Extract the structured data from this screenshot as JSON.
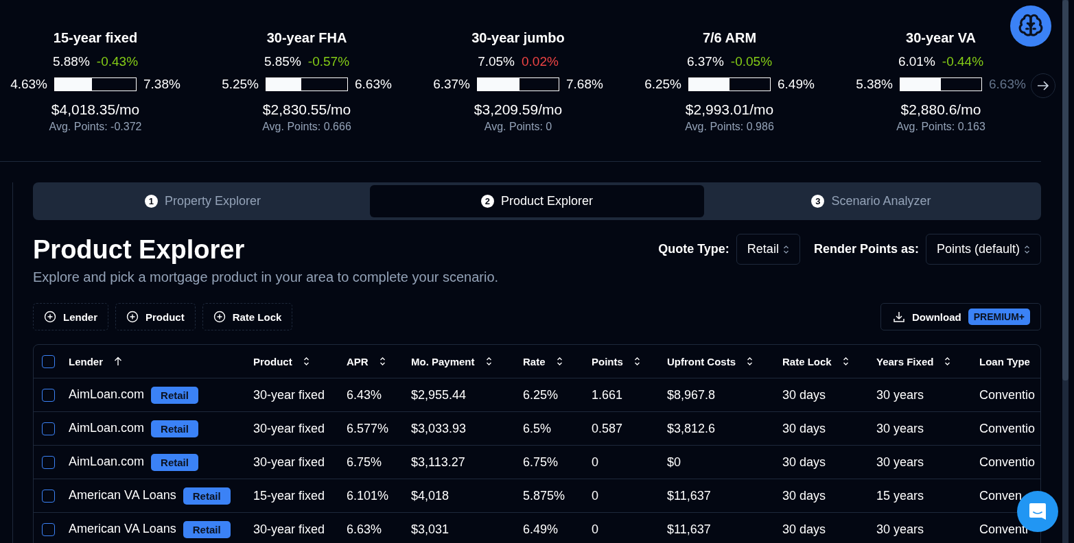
{
  "rates": [
    {
      "title": "15-year fixed",
      "rate": "5.88%",
      "change": "-0.43%",
      "kind": "down",
      "low": "4.63%",
      "high": "7.38%",
      "level": 0.46,
      "payment": "$4,018.35/mo",
      "points": "Avg. Points: -0.372"
    },
    {
      "title": "30-year FHA",
      "rate": "5.85%",
      "change": "-0.57%",
      "kind": "down",
      "low": "5.25%",
      "high": "6.63%",
      "level": 0.43,
      "payment": "$2,830.55/mo",
      "points": "Avg. Points: 0.666"
    },
    {
      "title": "30-year jumbo",
      "rate": "7.05%",
      "change": "0.02%",
      "kind": "up",
      "low": "6.37%",
      "high": "7.68%",
      "level": 0.52,
      "payment": "$3,209.59/mo",
      "points": "Avg. Points: 0"
    },
    {
      "title": "7/6 ARM",
      "rate": "6.37%",
      "change": "-0.05%",
      "kind": "down",
      "low": "6.25%",
      "high": "6.49%",
      "level": 0.5,
      "payment": "$2,993.01/mo",
      "points": "Avg. Points: 0.986"
    },
    {
      "title": "30-year VA",
      "rate": "6.01%",
      "change": "-0.44%",
      "kind": "down",
      "low": "5.38%",
      "high": "6.63%",
      "level": 0.5,
      "payment": "$2,880.6/mo",
      "points": "Avg. Points: 0.163"
    }
  ],
  "steps": [
    {
      "number": "1",
      "label": "Property Explorer",
      "selected": false
    },
    {
      "number": "2",
      "label": "Product Explorer",
      "selected": true
    },
    {
      "number": "3",
      "label": "Scenario Analyzer",
      "selected": false
    }
  ],
  "heading": "Product Explorer",
  "subtitle": "Explore and pick a mortgage product in your area to complete your scenario.",
  "quote_type": {
    "label": "Quote Type:",
    "value": "Retail"
  },
  "render_points": {
    "label": "Render Points as:",
    "value": "Points (default)"
  },
  "filters": [
    "Lender",
    "Product",
    "Rate Lock"
  ],
  "download": {
    "label": "Download",
    "badge": "PREMIUM+"
  },
  "table": {
    "select_all_checked": false,
    "columns": [
      {
        "label": "Lender",
        "kind": "asc"
      },
      {
        "label": "Product",
        "kind": "both"
      },
      {
        "label": "APR",
        "kind": "both"
      },
      {
        "label": "Mo. Payment",
        "kind": "both"
      },
      {
        "label": "Rate",
        "kind": "both"
      },
      {
        "label": "Points",
        "kind": "both"
      },
      {
        "label": "Upfront Costs",
        "kind": "both"
      },
      {
        "label": "Rate Lock",
        "kind": "both"
      },
      {
        "label": "Years Fixed",
        "kind": "both"
      },
      {
        "label": "Loan Type",
        "kind": "none"
      }
    ],
    "rows": [
      {
        "checked": false,
        "tag": "Retail",
        "cells": [
          "AimLoan.com",
          "30-year fixed",
          "6.43%",
          "$2,955.44",
          "6.25%",
          "1.661",
          "$8,967.8",
          "30 days",
          "30 years",
          "Conventio"
        ]
      },
      {
        "checked": false,
        "tag": "Retail",
        "cells": [
          "AimLoan.com",
          "30-year fixed",
          "6.577%",
          "$3,033.93",
          "6.5%",
          "0.587",
          "$3,812.6",
          "30 days",
          "30 years",
          "Conventio"
        ]
      },
      {
        "checked": false,
        "tag": "Retail",
        "cells": [
          "AimLoan.com",
          "30-year fixed",
          "6.75%",
          "$3,113.27",
          "6.75%",
          "0",
          "$0",
          "30 days",
          "30 years",
          "Conventio"
        ]
      },
      {
        "checked": false,
        "tag": "Retail",
        "cells": [
          "American VA Loans",
          "15-year fixed",
          "6.101%",
          "$4,018",
          "5.875%",
          "0",
          "$11,637",
          "30 days",
          "15 years",
          "Conven"
        ]
      },
      {
        "checked": false,
        "tag": "Retail",
        "cells": [
          "American VA Loans",
          "30-year fixed",
          "6.63%",
          "$3,031",
          "6.49%",
          "0",
          "$11,637",
          "30 days",
          "30 years",
          "Conventi"
        ]
      }
    ]
  }
}
